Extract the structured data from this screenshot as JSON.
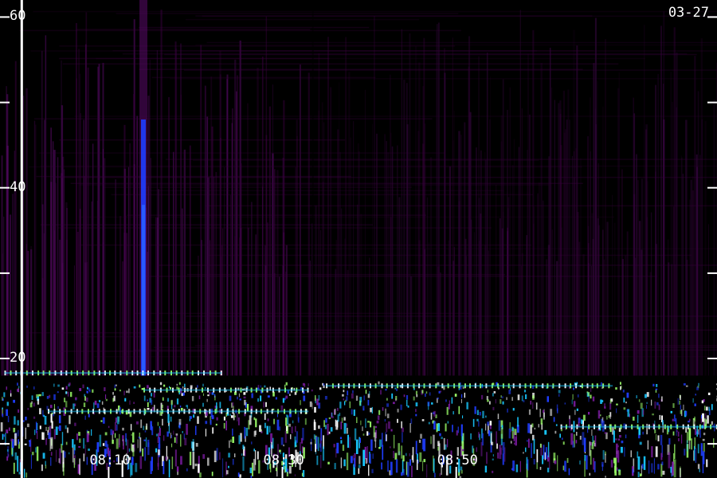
{
  "header": {
    "date": "03-27"
  },
  "chart_data": {
    "type": "heatmap",
    "title": "",
    "xlabel": "",
    "ylabel": "",
    "y_ticks_major": [
      20,
      40,
      60
    ],
    "y_ticks_minor": [
      10,
      30,
      50
    ],
    "ylim": [
      6,
      62
    ],
    "x_ticks": [
      "08:10",
      "08:30",
      "08:50"
    ],
    "x_tick_minutes": [
      10,
      30,
      50
    ],
    "xlim_minutes": [
      -2.5,
      80
    ],
    "cursor_minute": 0,
    "segment_boundary_minute": 33.5,
    "features": [
      {
        "kind": "vertical-band",
        "minute": 14,
        "freq_from": 18,
        "freq_to": 62
      },
      {
        "kind": "horizontal-line",
        "freq": 18.3,
        "minute_from": -2,
        "minute_to": 23
      },
      {
        "kind": "horizontal-line",
        "freq": 16.3,
        "minute_from": 14,
        "minute_to": 33
      },
      {
        "kind": "horizontal-line",
        "freq": 16.8,
        "minute_from": 35,
        "minute_to": 68
      },
      {
        "kind": "horizontal-line",
        "freq": 13.8,
        "minute_from": 3,
        "minute_to": 33
      },
      {
        "kind": "horizontal-line",
        "freq": 12.0,
        "minute_from": 62,
        "minute_to": 80
      }
    ],
    "colormap": [
      "#000000",
      "#3a003f",
      "#5a0a6a",
      "#7a1aa0",
      "#1f3dff",
      "#18c8ff",
      "#9cff6a",
      "#ffffff"
    ]
  }
}
